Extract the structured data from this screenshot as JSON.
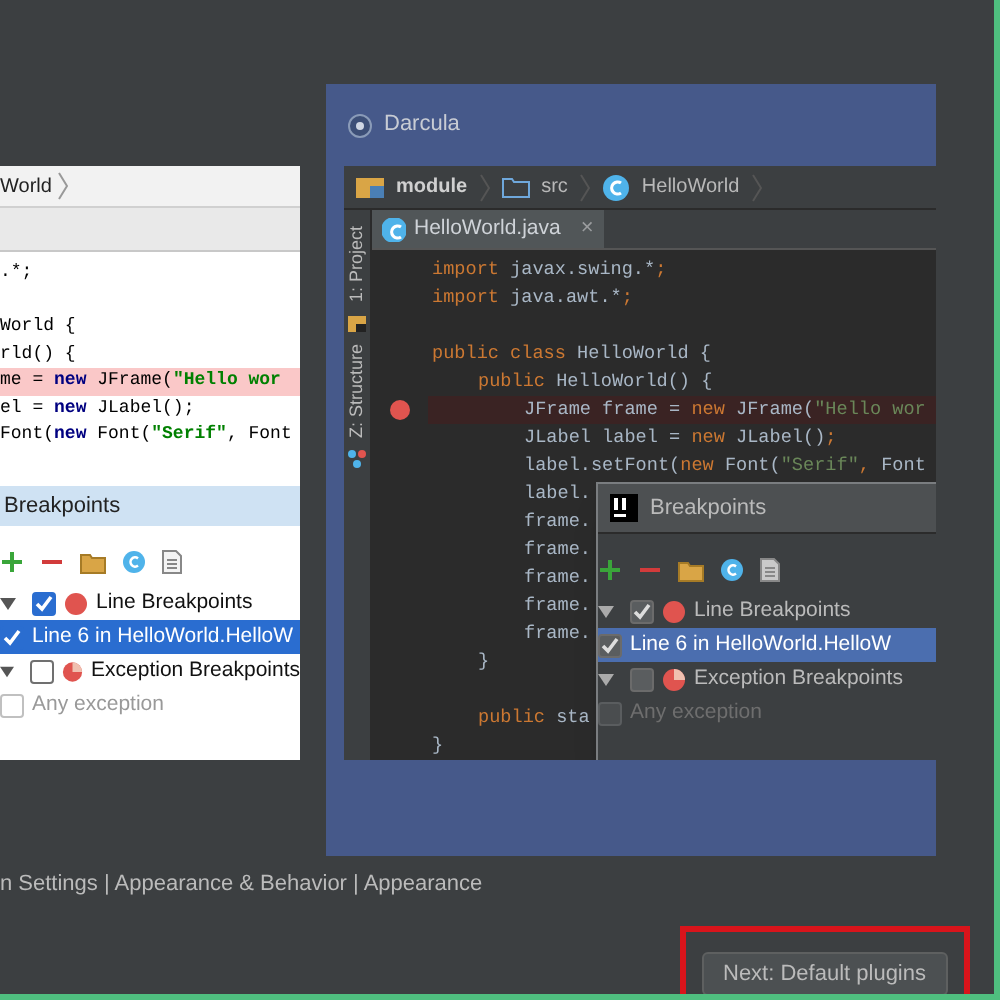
{
  "themes": [
    {
      "kind": "light",
      "selected": false,
      "breadcrumb": [
        "World"
      ],
      "code": [
        {
          "segments": [
            {
              "kind": "plain",
              "text": ".*;"
            }
          ]
        },
        {
          "gap_before": true,
          "segments": [
            {
              "kind": "plain",
              "text": "World {"
            }
          ]
        },
        {
          "segments": [
            {
              "kind": "plain",
              "text": "rld() {"
            }
          ]
        },
        {
          "breakpoint": true,
          "segments": [
            {
              "kind": "plain",
              "text": "me = "
            },
            {
              "kind": "keyword",
              "text": "new"
            },
            {
              "kind": "plain",
              "text": " JFrame("
            },
            {
              "kind": "string",
              "text": "\"Hello wor"
            }
          ]
        },
        {
          "segments": [
            {
              "kind": "plain",
              "text": "el = "
            },
            {
              "kind": "keyword",
              "text": "new"
            },
            {
              "kind": "plain",
              "text": " JLabel();"
            }
          ]
        },
        {
          "segments": [
            {
              "kind": "plain",
              "text": "Font("
            },
            {
              "kind": "keyword",
              "text": "new"
            },
            {
              "kind": "plain",
              "text": " Font("
            },
            {
              "kind": "string",
              "text": "\"Serif\""
            },
            {
              "kind": "plain",
              "text": ", Font"
            }
          ]
        }
      ],
      "dialog": {
        "title": "Breakpoints",
        "tree": [
          {
            "label": "Line Breakpoints",
            "checked": true,
            "expanded": true,
            "selected": false,
            "kind": "line",
            "children": [
              {
                "label": "Line 6 in HelloWorld.HelloW",
                "checked": true,
                "selected": true,
                "disabled": false
              }
            ]
          },
          {
            "label": "Exception Breakpoints",
            "checked": false,
            "expanded": true,
            "selected": false,
            "kind": "exception",
            "children": [
              {
                "label": "Any exception",
                "checked": false,
                "selected": false,
                "disabled": true
              }
            ]
          }
        ]
      }
    },
    {
      "kind": "dark",
      "selected": true,
      "label": "Darcula",
      "breadcrumb": [
        "module",
        "src",
        "HelloWorld"
      ],
      "tab": "HelloWorld.java",
      "tab_close": "×",
      "tool_tabs": [
        "1: Project",
        "Z: Structure"
      ],
      "code": [
        {
          "segments": [
            {
              "kind": "keyword",
              "text": "import"
            },
            {
              "kind": "plain",
              "text": " javax.swing.*"
            },
            {
              "kind": "keyword",
              "text": ";"
            }
          ]
        },
        {
          "segments": [
            {
              "kind": "keyword",
              "text": "import"
            },
            {
              "kind": "plain",
              "text": " java.awt.*"
            },
            {
              "kind": "keyword",
              "text": ";"
            }
          ]
        },
        {
          "gap_before": true,
          "segments": [
            {
              "kind": "keyword",
              "text": "public class"
            },
            {
              "kind": "plain",
              "text": " HelloWorld {"
            }
          ],
          "children": [
            {
              "segments": [
                {
                  "kind": "keyword",
                  "text": "public"
                },
                {
                  "kind": "plain",
                  "text": " HelloWorld() {"
                }
              ],
              "children": [
                {
                  "breakpoint": true,
                  "segments": [
                    {
                      "kind": "plain",
                      "text": "JFrame frame = "
                    },
                    {
                      "kind": "keyword",
                      "text": "new"
                    },
                    {
                      "kind": "plain",
                      "text": " JFrame("
                    },
                    {
                      "kind": "string",
                      "text": "\"Hello wor"
                    }
                  ]
                },
                {
                  "segments": [
                    {
                      "kind": "plain",
                      "text": "JLabel label = "
                    },
                    {
                      "kind": "keyword",
                      "text": "new"
                    },
                    {
                      "kind": "plain",
                      "text": " JLabel()"
                    },
                    {
                      "kind": "keyword",
                      "text": ";"
                    }
                  ]
                },
                {
                  "segments": [
                    {
                      "kind": "plain",
                      "text": "label.setFont("
                    },
                    {
                      "kind": "keyword",
                      "text": "new"
                    },
                    {
                      "kind": "plain",
                      "text": " Font("
                    },
                    {
                      "kind": "string",
                      "text": "\"Serif\""
                    },
                    {
                      "kind": "keyword",
                      "text": ","
                    },
                    {
                      "kind": "plain",
                      "text": " Font"
                    }
                  ]
                },
                {
                  "segments": [
                    {
                      "kind": "plain",
                      "text": "label."
                    }
                  ]
                },
                {
                  "segments": [
                    {
                      "kind": "plain",
                      "text": "frame."
                    }
                  ]
                },
                {
                  "segments": [
                    {
                      "kind": "plain",
                      "text": "frame."
                    }
                  ]
                },
                {
                  "segments": [
                    {
                      "kind": "plain",
                      "text": "frame."
                    }
                  ]
                },
                {
                  "segments": [
                    {
                      "kind": "plain",
                      "text": "frame."
                    }
                  ]
                },
                {
                  "segments": [
                    {
                      "kind": "plain",
                      "text": "frame."
                    }
                  ]
                }
              ]
            },
            {
              "segments": [
                {
                  "kind": "plain",
                  "text": "}"
                }
              ]
            },
            {
              "gap_before": true,
              "segments": [
                {
                  "kind": "keyword",
                  "text": "public"
                },
                {
                  "kind": "plain",
                  "text": " sta"
                }
              ]
            }
          ]
        },
        {
          "segments": [
            {
              "kind": "plain",
              "text": "}"
            }
          ]
        }
      ],
      "dialog": {
        "title": "Breakpoints",
        "tree": [
          {
            "label": "Line Breakpoints",
            "checked": true,
            "expanded": true,
            "selected": false,
            "kind": "line",
            "children": [
              {
                "label": "Line 6 in HelloWorld.HelloW",
                "checked": true,
                "selected": true,
                "disabled": false
              }
            ]
          },
          {
            "label": "Exception Breakpoints",
            "checked": false,
            "expanded": true,
            "selected": false,
            "kind": "exception",
            "children": [
              {
                "label": "Any exception",
                "checked": false,
                "selected": false,
                "disabled": true
              }
            ]
          }
        ]
      }
    }
  ],
  "settings_path": "n Settings | Appearance & Behavior | Appearance",
  "next_button": "Next: Default plugins",
  "next_button_highlighted": true
}
